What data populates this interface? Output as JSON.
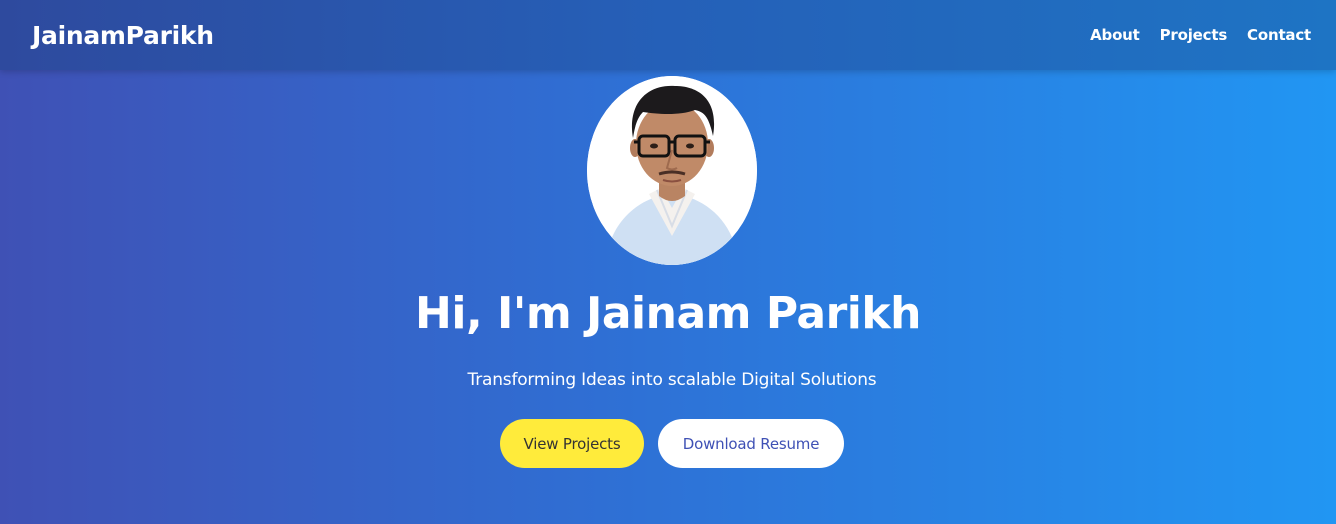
{
  "header": {
    "brand": "JainamParikh",
    "nav": [
      {
        "label": "About"
      },
      {
        "label": "Projects"
      },
      {
        "label": "Contact"
      }
    ]
  },
  "hero": {
    "avatar_icon": "profile-photo",
    "title": "Hi, I'm Jainam Parikh",
    "subtitle": "Transforming Ideas into scalable Digital Solutions",
    "primary_button": "View Projects",
    "secondary_button": "Download Resume"
  },
  "colors": {
    "gradient_start": "#3f51b5",
    "gradient_end": "#2196f3",
    "primary_button_bg": "#ffeb3b",
    "secondary_button_text": "#3f51b5"
  }
}
